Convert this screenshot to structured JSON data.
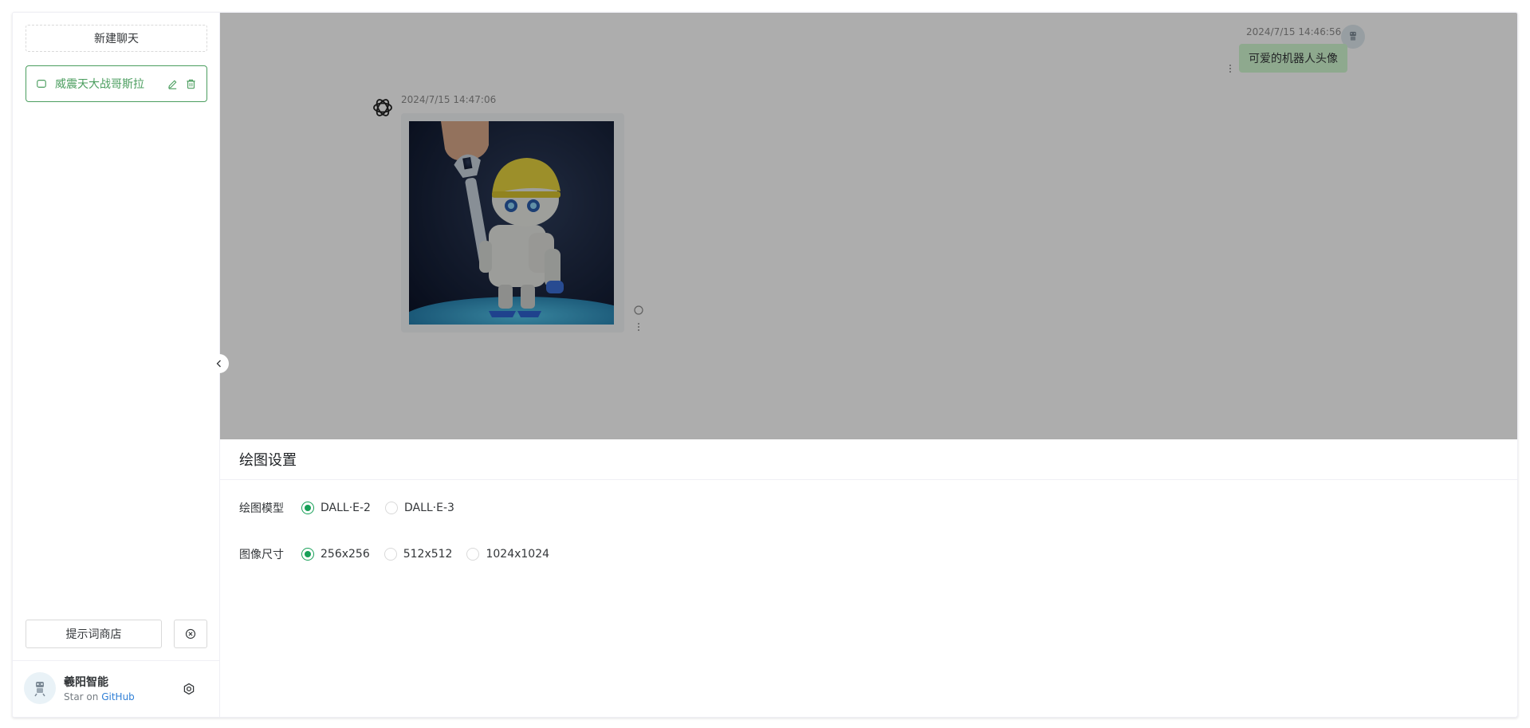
{
  "sidebar": {
    "new_chat_label": "新建聊天",
    "chat_items": [
      {
        "title": "威震天大战哥斯拉"
      }
    ],
    "prompt_store_label": "提示词商店",
    "user": {
      "name": "羲阳智能",
      "desc_prefix": "Star on",
      "desc_link": "GitHub"
    }
  },
  "chat": {
    "messages": [
      {
        "role": "user",
        "time": "2024/7/15 14:46:56",
        "text": "可爱的机器人头像"
      },
      {
        "role": "assistant",
        "time": "2024/7/15 14:47:06",
        "image_alt": "robot-image"
      }
    ]
  },
  "drawer": {
    "title": "绘图设置",
    "model_label": "绘图模型",
    "model_options": [
      "DALL·E-2",
      "DALL·E-3"
    ],
    "model_selected": "DALL·E-2",
    "size_label": "图像尺寸",
    "size_options": [
      "256x256",
      "512x512",
      "1024x1024"
    ],
    "size_selected": "256x256"
  },
  "colors": {
    "accent": "#18a058",
    "active_chat": "#4b9e5f",
    "user_bubble": "#d2f9d1",
    "link": "#2f7fd6"
  }
}
